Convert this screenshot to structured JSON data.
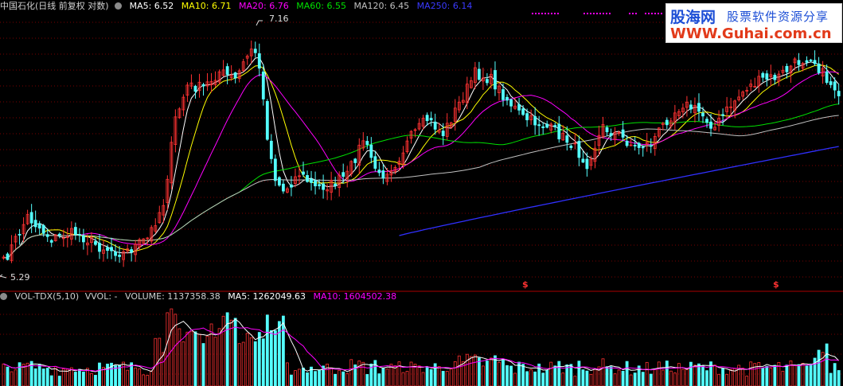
{
  "price_panel": {
    "stock_title": "中国石化(日线 前复权 对数)",
    "indicators": [
      {
        "label": "MA5: 6.52",
        "color": "#ffffff"
      },
      {
        "label": "MA10: 6.71",
        "color": "#ffff00"
      },
      {
        "label": "MA20: 6.76",
        "color": "#ff00ff"
      },
      {
        "label": "MA60: 6.55",
        "color": "#00e000"
      },
      {
        "label": "MA120: 6.45",
        "color": "#c0c0c0"
      },
      {
        "label": "MA250: 6.14",
        "color": "#3030ff"
      }
    ],
    "high_label": "7.16",
    "low_label": "5.29",
    "marker_symbol": "$"
  },
  "volume_panel": {
    "indicator_name": "VOL-TDX(5,10)",
    "vvol_label": "VVOL: -",
    "volume_label": "VOLUME: 1137358.38",
    "ma5_label": "MA5: 1262049.63",
    "ma10_label": "MA10: 1604502.38",
    "colors": {
      "volume": "#c8c8c8",
      "ma5": "#ffffff",
      "ma10": "#ff00ff"
    }
  },
  "watermark": {
    "site_name": "股海网",
    "slogan": "股票软件资源分享",
    "url": "WWW.Guhai.com.cn"
  },
  "colors": {
    "background": "#000000",
    "up": "#ff3232",
    "down": "#54ffff",
    "grid": "#7a0000",
    "separator": "#aa0000",
    "ma5": "#ffffff",
    "ma10": "#ffff00",
    "ma20": "#ff00ff",
    "ma60": "#00e000",
    "ma120": "#c0c0c0",
    "ma250": "#3030ff"
  },
  "chart_data": {
    "type": "candlestick",
    "price_scale": "log",
    "observed_high": 7.16,
    "observed_low": 5.29,
    "approx_range": [
      5.25,
      7.2
    ],
    "candle_count": 210,
    "key_points": [
      {
        "label": "7.16",
        "value": 7.16
      },
      {
        "label": "5.29",
        "value": 5.29
      }
    ],
    "last_ma_values": {
      "MA5": 6.52,
      "MA10": 6.71,
      "MA20": 6.76,
      "MA60": 6.55,
      "MA120": 6.45,
      "MA250": 6.14
    },
    "volume": {
      "last": 1137358.38,
      "ma5": 1262049.63,
      "ma10": 1604502.38
    }
  }
}
